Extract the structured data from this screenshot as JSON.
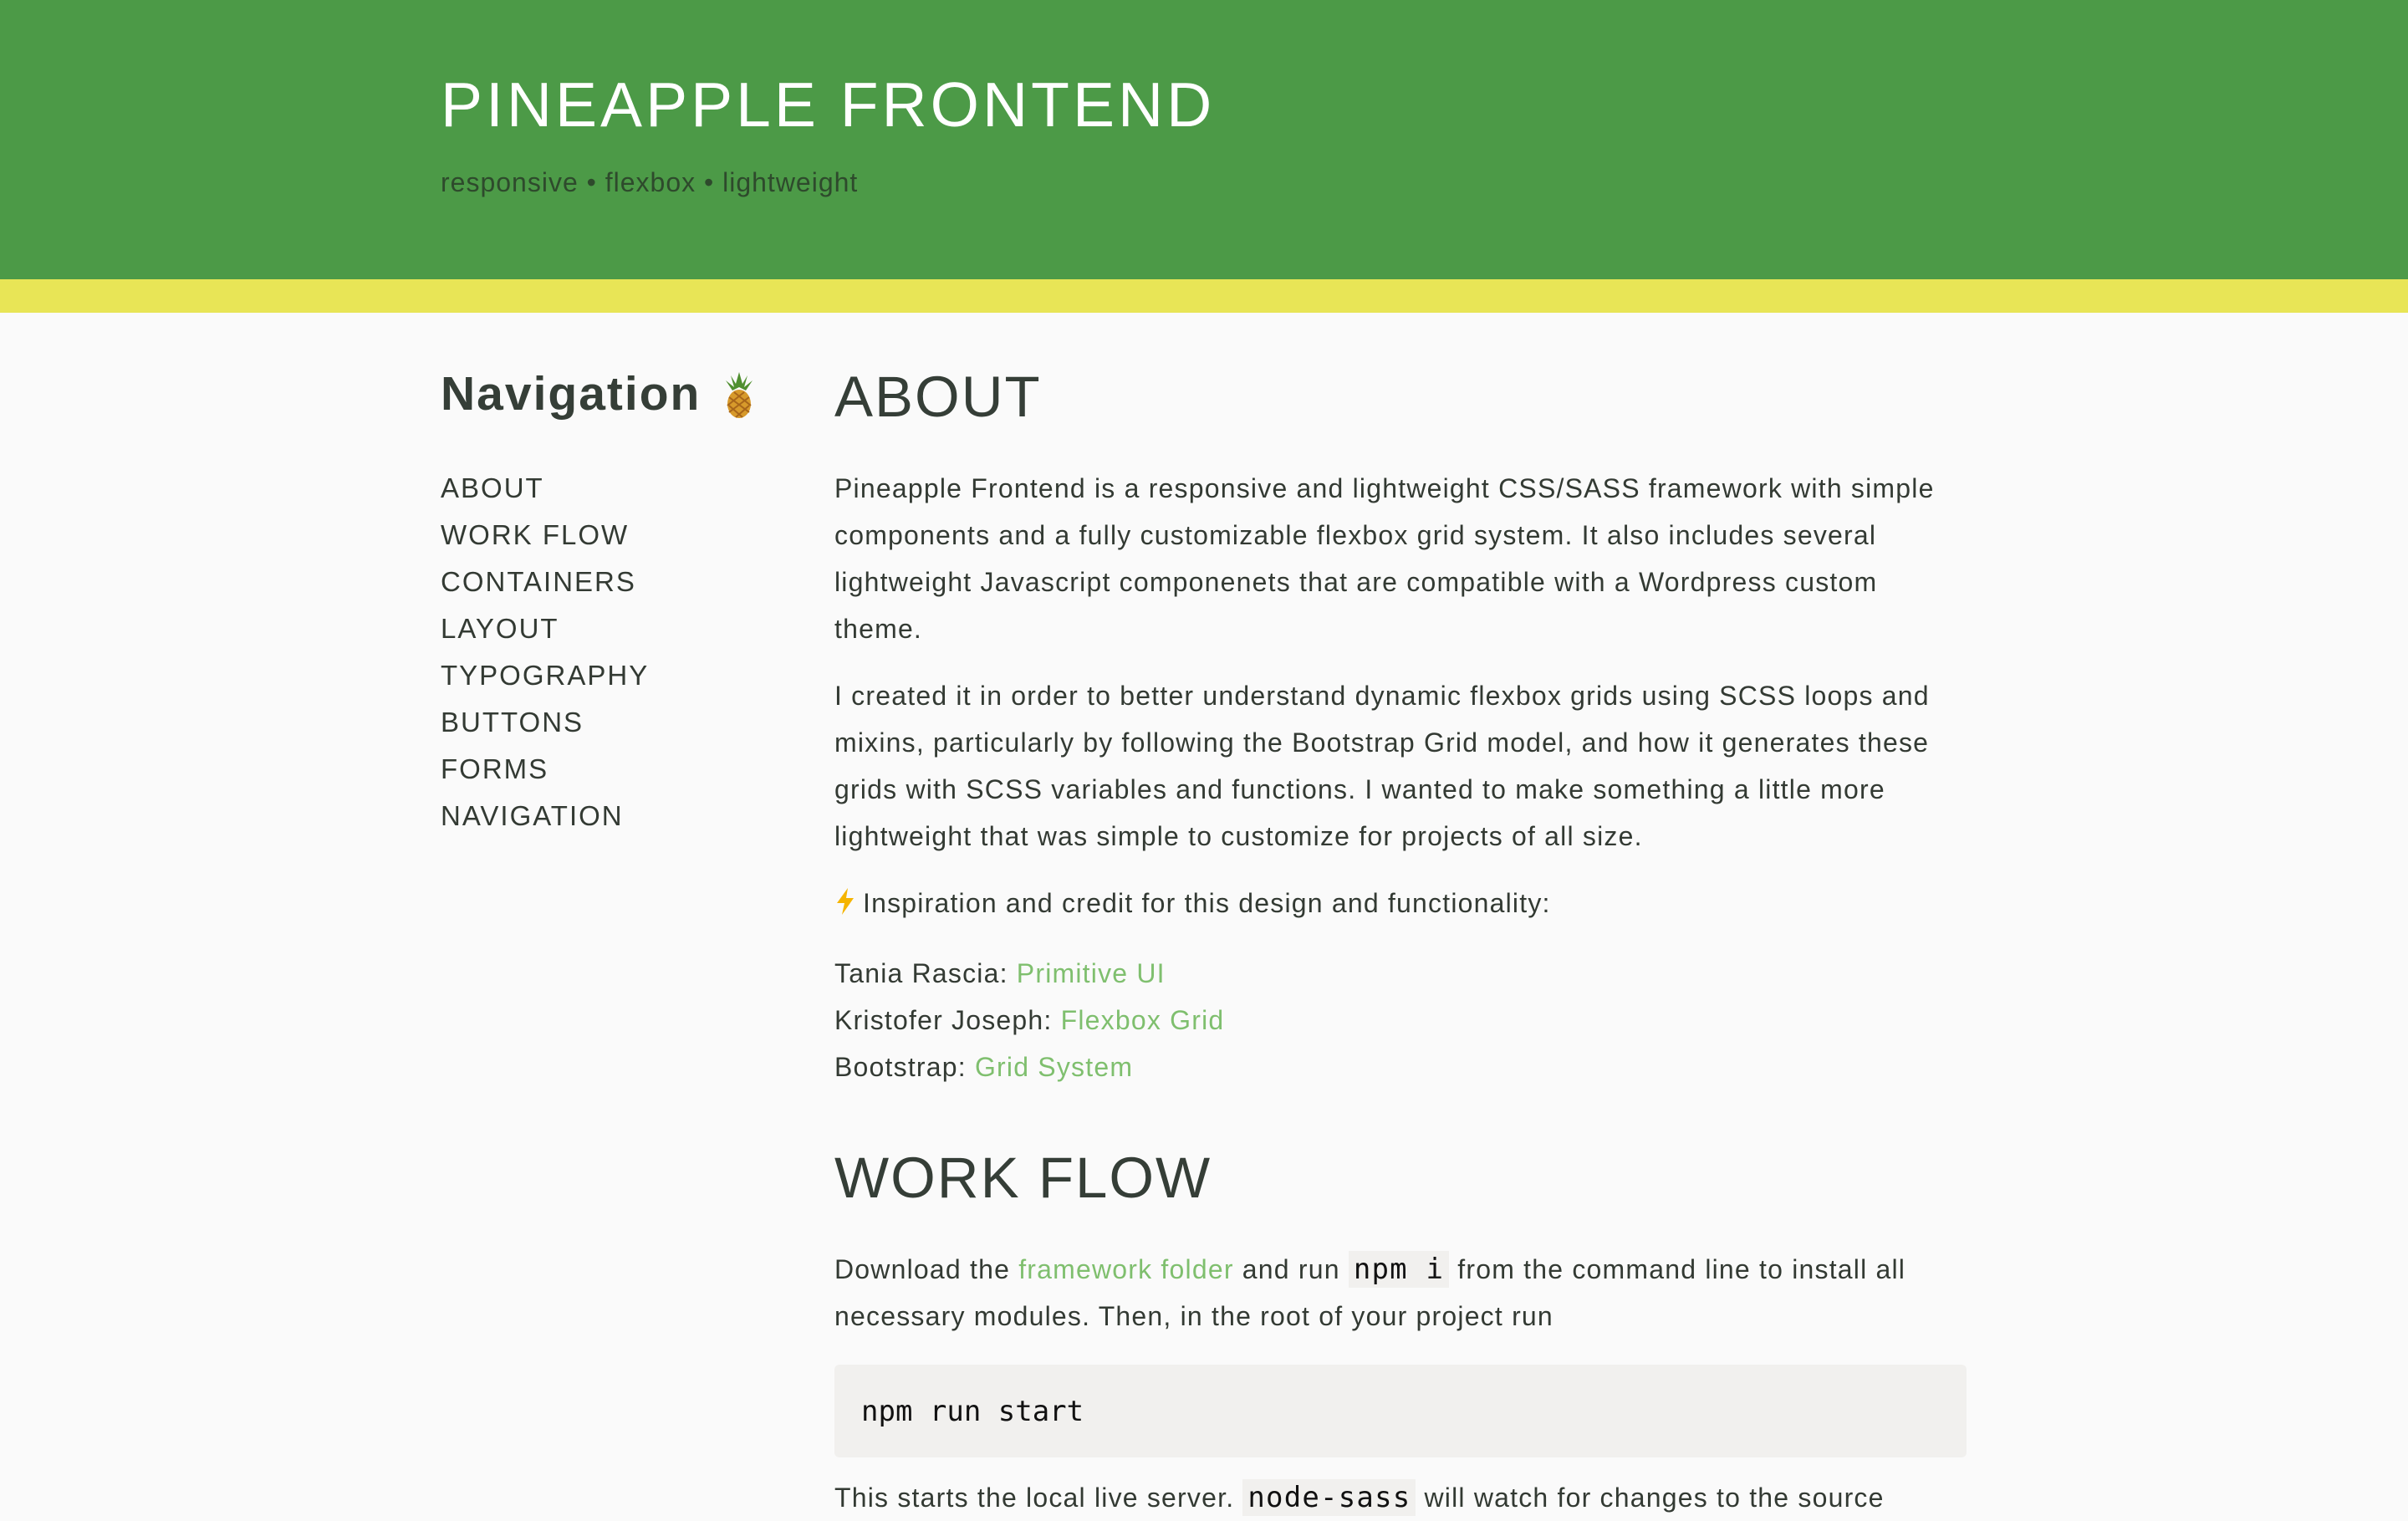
{
  "header": {
    "title": "PINEAPPLE FRONTEND",
    "tagline": "responsive • flexbox • lightweight",
    "bg_color": "#4c9a47",
    "stripe_color": "#e8e556"
  },
  "sidebar": {
    "heading": "Navigation",
    "heading_icon": "pineapple-icon",
    "items": [
      {
        "label": "ABOUT"
      },
      {
        "label": "WORK FLOW"
      },
      {
        "label": "CONTAINERS"
      },
      {
        "label": "LAYOUT"
      },
      {
        "label": "TYPOGRAPHY"
      },
      {
        "label": "BUTTONS"
      },
      {
        "label": "FORMS"
      },
      {
        "label": "NAVIGATION"
      }
    ]
  },
  "about": {
    "heading": "ABOUT",
    "p1": "Pineapple Frontend is a responsive and lightweight CSS/SASS framework with simple components and a fully customizable flexbox grid system. It also includes several lightweight Javascript componenets that are compatible with a Wordpress custom theme.",
    "p2": "I created it in order to better understand dynamic flexbox grids using SCSS loops and mixins, particularly by following the Bootstrap Grid model, and how it generates these grids with SCSS variables and functions. I wanted to make something a little more lightweight that was simple to customize for projects of all size.",
    "inspiration_icon": "lightning-icon",
    "inspiration": "Inspiration and credit for this design and functionality:",
    "credits": [
      {
        "name": "Tania Rascia: ",
        "link": "Primitive UI"
      },
      {
        "name": "Kristofer Joseph: ",
        "link": "Flexbox Grid"
      },
      {
        "name": "Bootstrap: ",
        "link": "Grid System"
      }
    ]
  },
  "workflow": {
    "heading": "WORK FLOW",
    "p1_pre": "Download the ",
    "p1_link": "framework folder",
    "p1_mid": " and run ",
    "p1_code": "npm i",
    "p1_post": " from the command line to install all necessary modules. Then, in the root of your project run",
    "code_block": "npm run start",
    "p2_pre": "This starts the local live server. ",
    "p2_code": "node-sass",
    "p2_post": " will watch for changes to the source"
  },
  "colors": {
    "link": "#7fbf6e",
    "text": "#333a33"
  }
}
